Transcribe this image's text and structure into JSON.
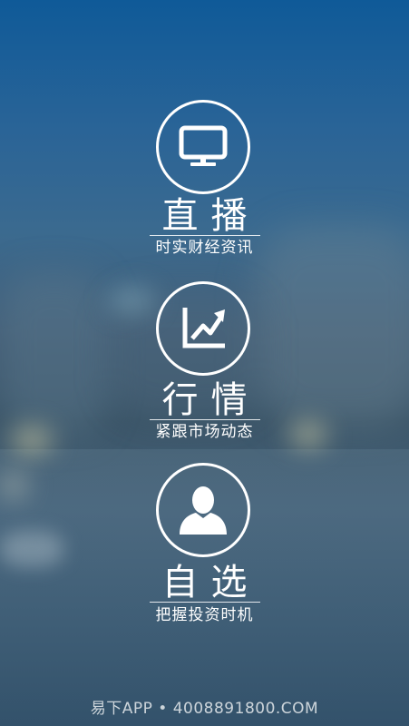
{
  "menu": [
    {
      "icon": "monitor-icon",
      "title": "直播",
      "subtitle": "时实财经资讯"
    },
    {
      "icon": "trend-chart-icon",
      "title": "行情",
      "subtitle": "紧跟市场动态"
    },
    {
      "icon": "user-icon",
      "title": "自选",
      "subtitle": "把握投资时机"
    }
  ],
  "footer": {
    "text": "易下APP • 4008891800.COM"
  },
  "colors": {
    "text": "#ffffff",
    "background_top": "#0f5a98",
    "background_bottom": "#34536c"
  }
}
